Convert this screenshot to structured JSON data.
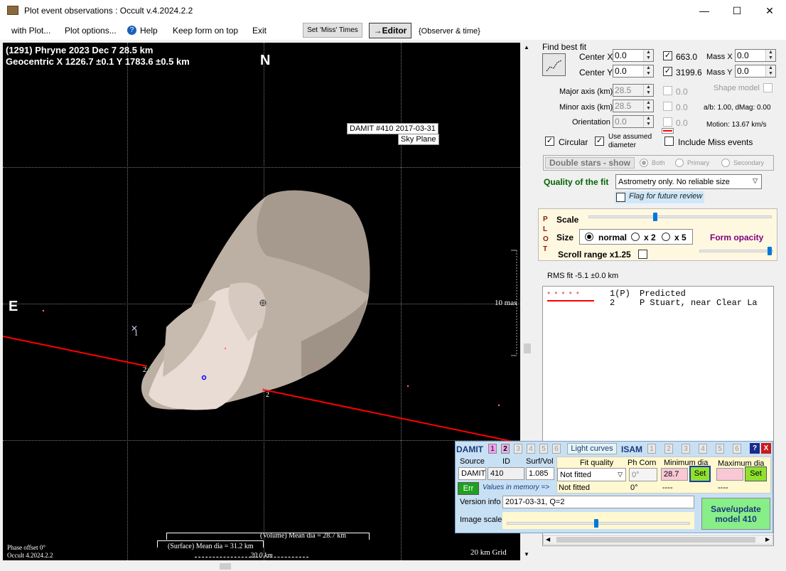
{
  "window": {
    "title": "Plot event observations : Occult v.4.2024.2.2",
    "min": "—",
    "max": "☐",
    "close": "✕"
  },
  "menu": {
    "with_plot": "with Plot...",
    "plot_options": "Plot options...",
    "help": "Help",
    "keep_on_top": "Keep form on top",
    "exit": "Exit",
    "set_miss": "Set 'Miss' Times",
    "editor": "→Editor",
    "observer_time": "{Observer & time}"
  },
  "plot": {
    "line1": "(1291) Phryne  2023 Dec 7   28.5 km",
    "line2": "Geocentric  X  1226.7 ±0.1  Y 1783.6 ±0.5 km",
    "north": "N",
    "east": "E",
    "damit_tag": "DAMIT #410 2017-03-31",
    "sky_plane": "Sky Plane",
    "mas": "10 mas",
    "chord1": "1",
    "chord2": "2",
    "chord2b": "2",
    "phase": "Phase offset 0°",
    "version": "Occult 4.2024.2.2",
    "vol_dia": "(Volume) Mean dia = 28.7 km",
    "surf_dia": "(Surface) Mean dia = 31.2 km",
    "scale_km": "20.0 km",
    "grid": "20 km Grid"
  },
  "fit": {
    "find_best_fit": "Find best fit",
    "center_x_label": "Center X",
    "center_x": "0.0",
    "center_y_label": "Center Y",
    "center_y": "0.0",
    "val_x": "663.0",
    "val_y": "3199.6",
    "mass_x_label": "Mass X",
    "mass_x": "0.0",
    "mass_y_label": "Mass Y",
    "mass_y": "0.0",
    "major_label": "Major axis (km)",
    "major": "28.5",
    "major_v": "0.0",
    "minor_label": "Minor axis (km)",
    "minor": "28.5",
    "minor_v": "0.0",
    "orient_label": "Orientation",
    "orient": "0.0",
    "orient_v": "0.0",
    "shape_model": "Shape model",
    "ab": "a/b: 1.00, dMag: 0.00",
    "motion": "Motion: 13.67 km/s",
    "circular": "Circular",
    "use_assumed": "Use assumed diameter",
    "include_miss": "Include Miss events",
    "double_stars": "Double stars - show",
    "both": "Both",
    "primary": "Primary",
    "secondary": "Secondary",
    "quality_label": "Quality of the fit",
    "quality": "Astrometry only. No reliable size",
    "flag": "Flag for future review"
  },
  "plotctl": {
    "p": "P",
    "l": "L",
    "o": "O",
    "t": "T",
    "scale": "Scale",
    "size": "Size",
    "normal": "normal",
    "x2": "x 2",
    "x5": "x 5",
    "form_opacity": "Form opacity",
    "scroll_range": "Scroll range x1.25",
    "scale_level": 0.36,
    "opacity_level": 0.98
  },
  "rms": "RMS fit -5.1 ±0.0 km",
  "legend": [
    {
      "num": "1(P)",
      "text": "Predicted"
    },
    {
      "num": "2",
      "text": "P Stuart, near Clear La"
    }
  ],
  "damit": {
    "damit": "DAMIT",
    "n1": "1",
    "n2": "2",
    "n3": "3",
    "n4": "4",
    "n5": "5",
    "n6": "6",
    "light_curves": "Light curves",
    "isam": "ISAM",
    "i1": "1",
    "i2": "2",
    "i3": "3",
    "i4": "4",
    "i5": "5",
    "i6": "6",
    "help": "?",
    "close": "X",
    "source_h": "Source",
    "id_h": "ID",
    "surf_h": "Surf/Vol",
    "fitq_h": "Fit quality",
    "phc_h": "Ph Corn",
    "mind_h": "Minimum dia",
    "maxd_h": "Maximum dia",
    "source": "DAMIT",
    "id": "410",
    "surf": "1.085",
    "fitq": "Not fitted",
    "phc": "0°",
    "mind": "28.7",
    "set1": "Set",
    "set2": "Set",
    "err": "Err",
    "mem": "Values in memory =>",
    "fitq2": "Not fitted",
    "phc2": "0°",
    "mind2": "----",
    "maxd2": "----",
    "version_label": "Version info",
    "version": "2017-03-31, Q=2",
    "image_scale": "Image scale",
    "save": "Save/update model 410",
    "image_scale_level": 0.49
  },
  "colors": {
    "accent": "#0078d7",
    "chord": "#ff0000",
    "plot_bg": "#000000",
    "damit_bg": "#c8e0f4",
    "save_bg": "#88ee88"
  }
}
